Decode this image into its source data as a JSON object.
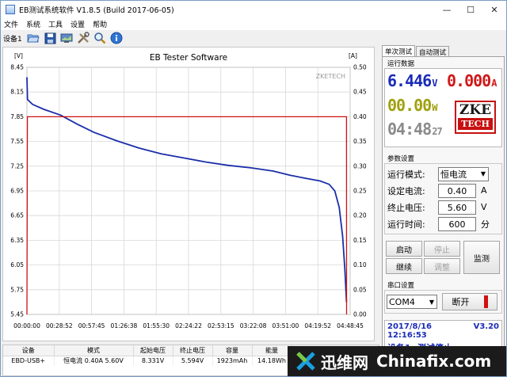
{
  "window": {
    "title": "EB测试系统软件 V1.8.5 (Build 2017-06-05)",
    "minimize": "—",
    "maximize": "☐",
    "close": "✕"
  },
  "menu": [
    "文件",
    "系统",
    "工具",
    "设置",
    "帮助"
  ],
  "toolbar": {
    "device_label": "设备1",
    "icons": [
      "open-folder-icon",
      "save-icon",
      "monitor-icon",
      "tools-icon",
      "zoom-icon",
      "info-icon"
    ]
  },
  "chart_data": {
    "type": "line",
    "title": "EB Tester Software",
    "watermark": "ZKETECH",
    "left_unit": "[V]",
    "right_unit": "[A]",
    "y_left_ticks": [
      "8.45",
      "8.15",
      "7.85",
      "7.55",
      "7.25",
      "6.95",
      "6.65",
      "6.35",
      "6.05",
      "5.75",
      "5.45"
    ],
    "y_right_ticks": [
      "0.50",
      "0.45",
      "0.40",
      "0.35",
      "0.30",
      "0.25",
      "0.20",
      "0.15",
      "0.10",
      "0.05",
      "0.00"
    ],
    "x_ticks": [
      "00:00:00",
      "00:28:52",
      "00:57:45",
      "01:26:38",
      "01:55:30",
      "02:24:22",
      "02:53:15",
      "03:22:08",
      "03:51:00",
      "04:19:52",
      "04:48:45"
    ],
    "ylim_left": [
      5.45,
      8.45
    ],
    "ylim_right": [
      0.0,
      0.5
    ],
    "xlim_minutes": [
      0,
      288.75
    ],
    "series": [
      {
        "axis": "left",
        "color": "#1a2ea8",
        "points": [
          [
            0,
            8.33
          ],
          [
            0.5,
            8.06
          ],
          [
            5,
            8.0
          ],
          [
            15,
            7.94
          ],
          [
            30,
            7.87
          ],
          [
            45,
            7.76
          ],
          [
            60,
            7.66
          ],
          [
            80,
            7.56
          ],
          [
            100,
            7.47
          ],
          [
            120,
            7.4
          ],
          [
            140,
            7.35
          ],
          [
            160,
            7.3
          ],
          [
            180,
            7.26
          ],
          [
            200,
            7.23
          ],
          [
            220,
            7.19
          ],
          [
            235,
            7.14
          ],
          [
            250,
            7.1
          ],
          [
            262,
            7.07
          ],
          [
            270,
            7.03
          ],
          [
            275,
            6.95
          ],
          [
            279,
            6.75
          ],
          [
            282,
            6.4
          ],
          [
            284,
            6.0
          ],
          [
            285.5,
            5.6
          ]
        ]
      },
      {
        "axis": "right",
        "color": "#d01010",
        "points": [
          [
            0,
            0.0
          ],
          [
            0.4,
            0.4
          ],
          [
            285.5,
            0.4
          ],
          [
            285.6,
            0.0
          ]
        ]
      }
    ],
    "grid": true
  },
  "right_panel": {
    "tabs": [
      "单次测试",
      "自动测试"
    ],
    "run_data_title": "运行数据",
    "voltage": "6.446",
    "voltage_unit": "V",
    "current": "0.000",
    "current_unit": "A",
    "power": "00.00",
    "power_unit": "W",
    "time": "04:48",
    "time_seconds": "27",
    "logo_top": "ZKE",
    "logo_bottom": "TECH",
    "params_title": "参数设置",
    "mode_label": "运行模式:",
    "mode_value": "恒电流",
    "current_set_label": "设定电流:",
    "current_set_value": "0.40",
    "current_set_unit": "A",
    "cutoff_label": "终止电压:",
    "cutoff_value": "5.60",
    "cutoff_unit": "V",
    "runtime_label": "运行时间:",
    "runtime_value": "600",
    "runtime_unit": "分",
    "btn_start": "启动",
    "btn_stop": "停止",
    "btn_continue": "继续",
    "btn_adjust": "调整",
    "btn_monitor": "监测",
    "serial_title": "串口设置",
    "port_value": "COM4",
    "btn_disconnect": "断开",
    "status_datetime": "2017/8/16 12:16:53",
    "status_version": "V3.20",
    "status_device": "设备1: 测试停止"
  },
  "table": {
    "headers": [
      "设备",
      "模式",
      "起始电压",
      "终止电压",
      "容量",
      "能量"
    ],
    "rows": [
      [
        "EBD-USB+",
        "恒电流 0.40A 5.60V",
        "8.331V",
        "5.594V",
        "1923mAh",
        "14.18Wh"
      ]
    ]
  },
  "watermark": {
    "cn_text": "迅维网",
    "en_text": "Chinafix.com"
  }
}
